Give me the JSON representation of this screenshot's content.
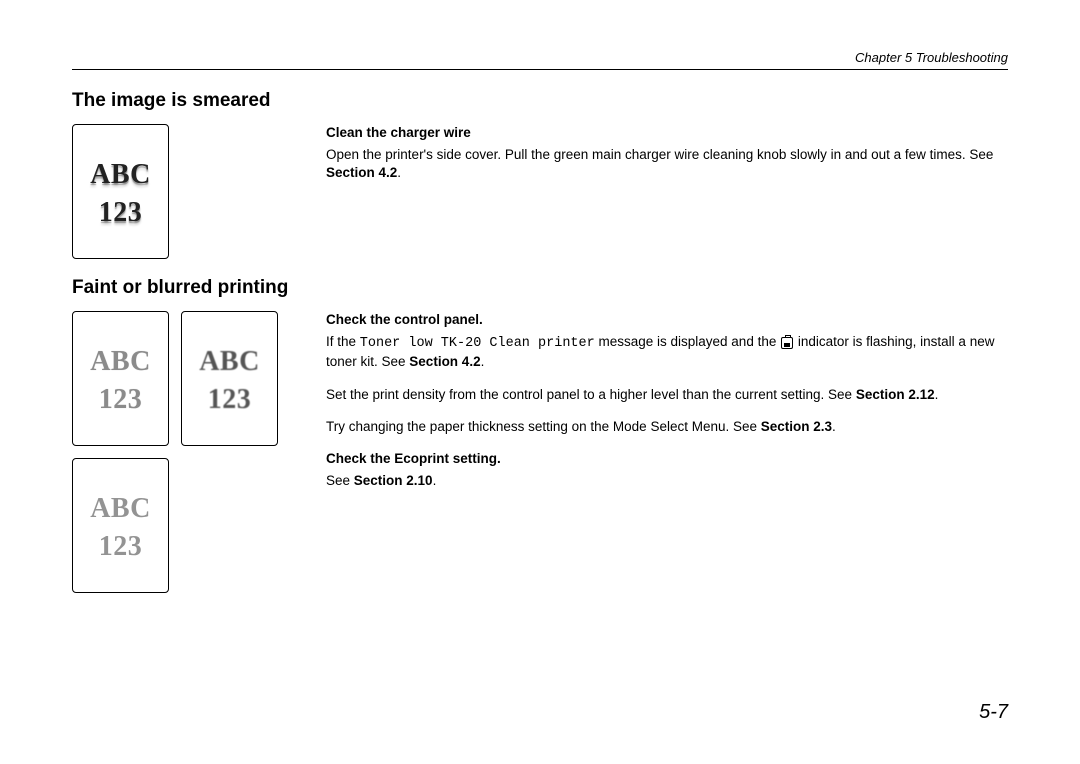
{
  "header": {
    "chapter": "Chapter 5 Troubleshooting"
  },
  "section1": {
    "title": "The image is smeared",
    "sample_line1": "ABC",
    "sample_line2": "123",
    "step1_title": "Clean the charger wire",
    "step1_body_a": "Open the printer's side cover. Pull the green main charger wire cleaning knob slowly in and out a few times. See ",
    "step1_body_b": "Section 4.2",
    "step1_body_c": "."
  },
  "section2": {
    "title": "Faint or blurred printing",
    "sample_line1": "ABC",
    "sample_line2": "123",
    "step1_title": "Check the control panel.",
    "step1_a": "If the ",
    "step1_mono": "Toner low TK-20 Clean printer",
    "step1_b": " message is displayed and the ",
    "step1_c": " indicator is flashing, install a new toner kit. See ",
    "step1_d": "Section 4.2",
    "step1_e": ".",
    "step2_a": "Set the print density from the control panel to a higher level than the current setting. See ",
    "step2_b": "Section 2.12",
    "step2_c": ".",
    "step3_a": "Try changing the paper thickness setting on the Mode Select Menu.  See ",
    "step3_b": "Section 2.3",
    "step3_c": ".",
    "step4_title": "Check the Ecoprint setting.",
    "step4_a": "See ",
    "step4_b": "Section 2.10",
    "step4_c": "."
  },
  "footer": {
    "page_number": "5-7"
  }
}
